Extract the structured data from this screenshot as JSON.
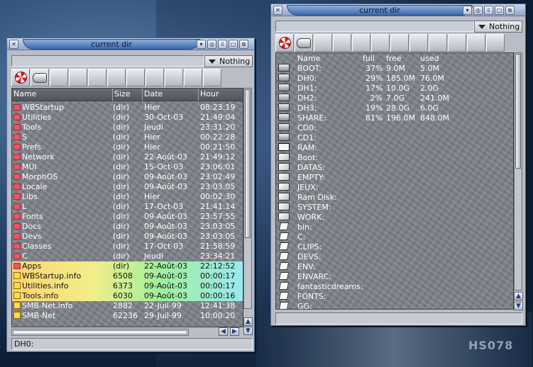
{
  "left_window": {
    "title": "current dir",
    "filter_label": "Nothing",
    "columns": [
      "Name",
      "Size",
      "Date",
      "Hour"
    ],
    "rows": [
      {
        "name": "WBStartup",
        "size": "(dir)",
        "date": "Hier",
        "hour": "08:23:19",
        "kind": "dir"
      },
      {
        "name": "Utilities",
        "size": "(dir)",
        "date": "30-Oct-03",
        "hour": "21:49:04",
        "kind": "dir"
      },
      {
        "name": "Tools",
        "size": "(dir)",
        "date": "Jeudi",
        "hour": "23:31:20",
        "kind": "dir"
      },
      {
        "name": "S",
        "size": "(dir)",
        "date": "Hier",
        "hour": "00:22:28",
        "kind": "dir"
      },
      {
        "name": "Prefs",
        "size": "(dir)",
        "date": "Hier",
        "hour": "00:21:50",
        "kind": "dir"
      },
      {
        "name": "Network",
        "size": "(dir)",
        "date": "22-Août-03",
        "hour": "21:49:12",
        "kind": "dir"
      },
      {
        "name": "MUI",
        "size": "(dir)",
        "date": "15-Oct-03",
        "hour": "23:06:01",
        "kind": "dir"
      },
      {
        "name": "MorphOS",
        "size": "(dir)",
        "date": "09-Août-03",
        "hour": "23:02:49",
        "kind": "dir"
      },
      {
        "name": "Locale",
        "size": "(dir)",
        "date": "09-Août-03",
        "hour": "23:03:05",
        "kind": "dir"
      },
      {
        "name": "Libs",
        "size": "(dir)",
        "date": "Hier",
        "hour": "00:02:30",
        "kind": "dir"
      },
      {
        "name": "L",
        "size": "(dir)",
        "date": "17-Oct-03",
        "hour": "21:41:14",
        "kind": "dir"
      },
      {
        "name": "Fonts",
        "size": "(dir)",
        "date": "09-Août-03",
        "hour": "23:57:55",
        "kind": "dir"
      },
      {
        "name": "Docs",
        "size": "(dir)",
        "date": "09-Août-03",
        "hour": "23:03:05",
        "kind": "dir"
      },
      {
        "name": "Devs",
        "size": "(dir)",
        "date": "09-Août-03",
        "hour": "23:03:05",
        "kind": "dir"
      },
      {
        "name": "Classes",
        "size": "(dir)",
        "date": "17-Oct-03",
        "hour": "21:58:59",
        "kind": "dir"
      },
      {
        "name": "C",
        "size": "(dir)",
        "date": "Jeudi",
        "hour": "23:34:21",
        "kind": "dir"
      },
      {
        "name": "Apps",
        "size": "(dir)",
        "date": "22-Août-03",
        "hour": "22:12:52",
        "kind": "dir-selected"
      },
      {
        "name": "WBStartup.info",
        "size": "6508",
        "date": "09-Août-03",
        "hour": "00:00:17",
        "kind": "file-selected"
      },
      {
        "name": "Utilities.info",
        "size": "6373",
        "date": "09-Août-03",
        "hour": "00:00:17",
        "kind": "file-selected"
      },
      {
        "name": "Tools.info",
        "size": "6030",
        "date": "09-Août-03",
        "hour": "00:00:16",
        "kind": "file-selected"
      },
      {
        "name": "SMB-Net.info",
        "size": "2882",
        "date": "22-Juil-99",
        "hour": "12:41:38",
        "kind": "file"
      },
      {
        "name": "SMB-Net",
        "size": "62236",
        "date": "29-Juil-99",
        "hour": "10:00:20",
        "kind": "file"
      }
    ],
    "status": "DH0:"
  },
  "right_window": {
    "title": "current dir",
    "filter_label": "Nothing",
    "columns": [
      "Name",
      "full",
      "free",
      "used"
    ],
    "rows": [
      {
        "name": "BOOT:",
        "full": "37%",
        "free": "9.0M",
        "used": "5.0M",
        "icon": "drive"
      },
      {
        "name": "DH0:",
        "full": "29%",
        "free": "185.0M",
        "used": "76.0M",
        "icon": "drive"
      },
      {
        "name": "DH1:",
        "full": "17%",
        "free": "10.0G",
        "used": "2.0G",
        "icon": "drive"
      },
      {
        "name": "DH2:",
        "full": "2%",
        "free": "7.0G",
        "used": "241.0M",
        "icon": "drive"
      },
      {
        "name": "DH3:",
        "full": "19%",
        "free": "28.0G",
        "used": "6.0G",
        "icon": "drive"
      },
      {
        "name": "SHARE:",
        "full": "81%",
        "free": "196.0M",
        "used": "848.0M",
        "icon": "drive"
      },
      {
        "name": "CD0:",
        "full": "",
        "free": "",
        "used": "",
        "icon": "drive"
      },
      {
        "name": "CD1:",
        "full": "",
        "free": "",
        "used": "",
        "icon": "drive"
      },
      {
        "name": "RAM:",
        "full": "",
        "free": "",
        "used": "",
        "icon": "ram"
      },
      {
        "name": "Boot:",
        "full": "",
        "free": "",
        "used": "",
        "icon": "assign"
      },
      {
        "name": "DATAS:",
        "full": "",
        "free": "",
        "used": "",
        "icon": "assign"
      },
      {
        "name": "EMPTY:",
        "full": "",
        "free": "",
        "used": "",
        "icon": "assign"
      },
      {
        "name": "JEUX:",
        "full": "",
        "free": "",
        "used": "",
        "icon": "assign"
      },
      {
        "name": "Ram Disk:",
        "full": "",
        "free": "",
        "used": "",
        "icon": "assign"
      },
      {
        "name": "SYSTEM:",
        "full": "",
        "free": "",
        "used": "",
        "icon": "assign"
      },
      {
        "name": "WORK:",
        "full": "",
        "free": "",
        "used": "",
        "icon": "assign"
      },
      {
        "name": "bin:",
        "full": "",
        "free": "",
        "used": "",
        "icon": "doc"
      },
      {
        "name": "C:",
        "full": "",
        "free": "",
        "used": "",
        "icon": "doc"
      },
      {
        "name": "CLIPS:",
        "full": "",
        "free": "",
        "used": "",
        "icon": "doc"
      },
      {
        "name": "DEVS:",
        "full": "",
        "free": "",
        "used": "",
        "icon": "doc"
      },
      {
        "name": "ENV:",
        "full": "",
        "free": "",
        "used": "",
        "icon": "doc"
      },
      {
        "name": "ENVARC:",
        "full": "",
        "free": "",
        "used": "",
        "icon": "doc"
      },
      {
        "name": "fantasticdreams:",
        "full": "",
        "free": "",
        "used": "",
        "icon": "doc"
      },
      {
        "name": "FONTS:",
        "full": "",
        "free": "",
        "used": "",
        "icon": "doc"
      },
      {
        "name": "GG:",
        "full": "",
        "free": "",
        "used": "",
        "icon": "doc"
      }
    ],
    "status": ""
  },
  "desktop_text": "HS078"
}
